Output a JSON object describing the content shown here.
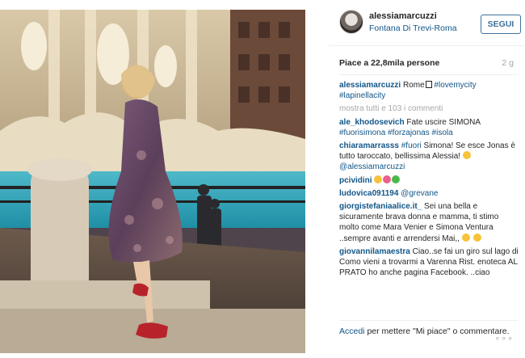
{
  "post": {
    "username": "alessiamarcuzzi",
    "location": "Fontana Di Trevi-Roma",
    "follow_label": "SEGUI",
    "likes_text": "Piace a 22,8mila persone",
    "time_ago": "2 g"
  },
  "caption": {
    "username": "alessiamarcuzzi",
    "text": "Rome",
    "tags": [
      "#lovemycity",
      "#lapinellacity"
    ]
  },
  "show_all_comments": "mostra tutti e 103 i commenti",
  "comments": [
    {
      "username": "ale_khodosevich",
      "text": "Fate uscire SIMONA",
      "tags": [
        "#fuorisimona",
        "#forzajonas",
        "#isola"
      ]
    },
    {
      "username": "chiaramarrasss",
      "tag1": "#fuori",
      "text": "Simona! Se esce Jonas è tutto taroccato, bellissima Alessia!",
      "mention": "@alessiamarcuzzi"
    },
    {
      "username": "pcividini"
    },
    {
      "username": "ludovica091194",
      "mention": "@grevane"
    },
    {
      "username": "giorgistefaniaalice.it_",
      "text": "Sei una bella e sicuramente brava donna e mamma, ti stimo molto come Mara Venier e Simona Ventura ..sempre avanti e arrendersi Mai,,"
    },
    {
      "username": "giovannilamaestra",
      "text": "Ciao..se fai un giro sul lago di Como vieni a trovarmi a Varenna Rist. enoteca AL PRATO ho anche pagina Facebook. ..ciao"
    }
  ],
  "footer": {
    "login_label": "Accedi",
    "rest_text": "per mettere \"Mi piace\" o commentare.",
    "more_label": "∘∘∘"
  },
  "colors": {
    "link_blue": "#125688",
    "button_blue": "#3f729b",
    "muted_gray": "#a5a7aa",
    "text_dark": "#262626"
  }
}
